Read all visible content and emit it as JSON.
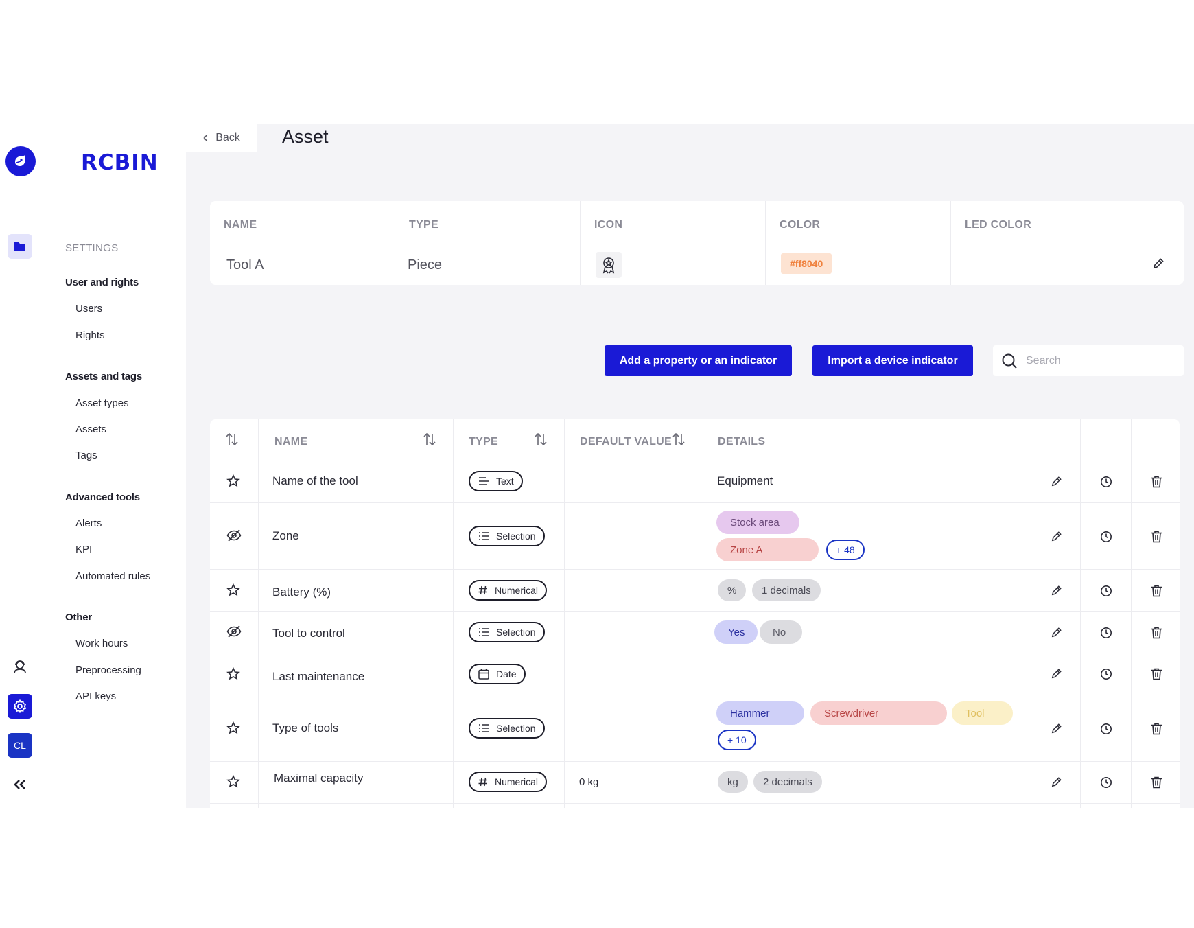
{
  "brand": {
    "name": "RCBIN"
  },
  "rail": {
    "avatar_initials": "CL"
  },
  "sidebar": {
    "title": "SETTINGS",
    "groups": [
      {
        "label": "User and rights",
        "items": [
          "Users",
          "Rights"
        ]
      },
      {
        "label": "Assets and tags",
        "items": [
          "Asset types",
          "Assets",
          "Tags"
        ]
      },
      {
        "label": "Advanced tools",
        "items": [
          "Alerts",
          "KPI",
          "Automated rules"
        ]
      },
      {
        "label": "Other",
        "items": [
          "Work hours",
          "Preprocessing",
          "API keys"
        ]
      }
    ]
  },
  "header": {
    "back_label": "Back",
    "title": "Asset"
  },
  "asset": {
    "columns": [
      "NAME",
      "TYPE",
      "ICON",
      "COLOR",
      "LED COLOR"
    ],
    "name": "Tool A",
    "type": "Piece",
    "icon": "award-ribbon-icon",
    "color": "#ff8040",
    "led_color": ""
  },
  "toolbar": {
    "add_label": "Add a property or an indicator",
    "import_label": "Import a device indicator",
    "search_placeholder": "Search"
  },
  "properties": {
    "columns": {
      "name": "NAME",
      "type": "TYPE",
      "default": "DEFAULT VALUE",
      "details": "DETAILS"
    },
    "rows": [
      {
        "icon": "star-icon",
        "name": "Name of the tool",
        "type": "Text",
        "default": "",
        "detail_text": "Equipment",
        "chips": []
      },
      {
        "icon": "eye-off-icon",
        "name": "Zone",
        "type": "Selection",
        "default": "",
        "detail_text": "",
        "chips": [
          "Stock area",
          "Zone A",
          "+ 48"
        ]
      },
      {
        "icon": "star-icon",
        "name": "Battery (%)",
        "type": "Numerical",
        "default": "",
        "detail_text": "",
        "chips": [
          "%",
          "1 decimals"
        ]
      },
      {
        "icon": "eye-off-icon",
        "name": "Tool to control",
        "type": "Selection",
        "default": "",
        "detail_text": "",
        "chips": [
          "Yes",
          "No"
        ]
      },
      {
        "icon": "star-icon",
        "name": "Last maintenance",
        "type": "Date",
        "default": "",
        "detail_text": "",
        "chips": []
      },
      {
        "icon": "star-icon",
        "name": "Type of tools",
        "type": "Selection",
        "default": "",
        "detail_text": "",
        "chips": [
          "Hammer",
          "Screwdriver",
          "Tool",
          "+ 10"
        ]
      },
      {
        "icon": "star-icon",
        "name": "Maximal capacity",
        "type": "Numerical",
        "default": "0 kg",
        "detail_text": "",
        "chips": [
          "kg",
          "2 decimals"
        ]
      }
    ]
  },
  "colors": {
    "accent": "#1a1ad6",
    "chip_purple": "#e6c8ee",
    "chip_red": "#f8d0d0",
    "chip_blue": "#cfd0f8",
    "chip_yellow": "#fbf0c8",
    "chip_gray": "#dcdce0"
  }
}
